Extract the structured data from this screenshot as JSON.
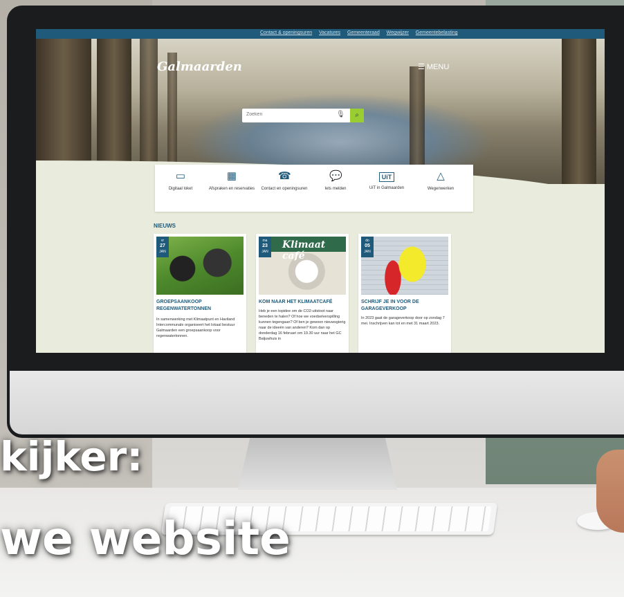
{
  "overlay": {
    "line1": "kijker:",
    "line2": "we website"
  },
  "topbar": {
    "links": [
      "Contact & openingsuren",
      "Vacatures",
      "Gemeenteraad",
      "Wegwijzer",
      "Gemeentebelasting"
    ]
  },
  "site": {
    "logo": "Galmaarden",
    "menu_label": "MENU"
  },
  "search": {
    "placeholder": "Zoeken"
  },
  "quicklinks": [
    {
      "label": "Digitaal loket",
      "icon": "laptop-icon"
    },
    {
      "label": "Afspraken en reservaties",
      "icon": "calendar-icon"
    },
    {
      "label": "Contact en openingsuren",
      "icon": "phone-icon"
    },
    {
      "label": "Iets melden",
      "icon": "chat-icon"
    },
    {
      "label": "UiT in Galmaarden",
      "icon": "uit-icon"
    },
    {
      "label": "Wegenwerken",
      "icon": "traffic-cone-icon"
    }
  ],
  "news": {
    "heading": "NIEUWS",
    "items": [
      {
        "day": "vr",
        "date": "27",
        "month": "JAN",
        "title": "GROEPSAANKOOP REGENWATERTONNEN",
        "body": "In samenwerking met Klimaatpunt en Haviland Intercommunale organiseert het lokaal bestuur Galmaarden een groepsaankoop voor regenwatertonnen."
      },
      {
        "day": "ma",
        "date": "23",
        "month": "JAN",
        "image_text": "Klimaat café",
        "title": "KOM NAAR HET KLIMAATCAFÉ",
        "body": "Heb je een topidee om de CO2-uitstoot naar beneden te halen? Of hoe we voedselverspilling kunnen tegengaan? Of ben je gewoon nieuwsgierig naar de ideeën van anderen? Kom dan op donderdag 16 februari om 19.30 uur naar het GC Baljuwhuis in"
      },
      {
        "day": "do",
        "date": "05",
        "month": "JAN",
        "title": "SCHRIJF JE IN VOOR DE GARAGEVERKOOP",
        "body": "In 2023 gaat de garageverkoop door op zondag 7 mei. Inschrijven kan tot en met 31 maart 2023."
      }
    ]
  }
}
